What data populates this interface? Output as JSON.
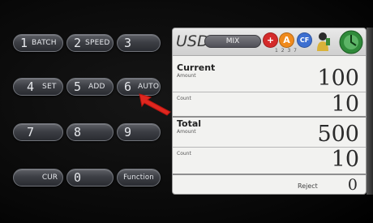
{
  "keypad": {
    "k1": {
      "num": "1",
      "label": "BATCH"
    },
    "k2": {
      "num": "2",
      "label": "SPEED"
    },
    "k3": {
      "num": "3"
    },
    "k4": {
      "num": "4",
      "label": "SET"
    },
    "k5": {
      "num": "5",
      "label": "ADD"
    },
    "k6": {
      "num": "6",
      "label": "AUTO"
    },
    "k7": {
      "num": "7"
    },
    "k8": {
      "num": "8"
    },
    "k9": {
      "num": "9"
    },
    "kcur": {
      "label": "CUR"
    },
    "k0": {
      "num": "0"
    },
    "kfunc": {
      "label": "Function"
    }
  },
  "display": {
    "currency": "USD",
    "mode_button": "MIX",
    "status_code": "1 2 3 7",
    "icons": [
      {
        "name": "plus-icon",
        "glyph": "+",
        "color": "#d42a2a"
      },
      {
        "name": "auto-icon",
        "glyph": "A",
        "color": "#f08a1c"
      },
      {
        "name": "cf-icon",
        "glyph": "CF",
        "color": "#3c6fd1"
      },
      {
        "name": "user-icon"
      },
      {
        "name": "dial-icon",
        "color": "#2f8a3a"
      }
    ],
    "current": {
      "title": "Current",
      "amount_label": "Amount",
      "amount": "100",
      "count_label": "Count",
      "count": "10"
    },
    "total": {
      "title": "Total",
      "amount_label": "Amount",
      "amount": "500",
      "count_label": "Count",
      "count": "10"
    },
    "reject_label": "Reject",
    "reject": "0"
  },
  "colors": {
    "background": "#0c0c0c",
    "key": "#3d3f45",
    "panel": "#f2f2f0",
    "arrow": "#e0271f"
  }
}
